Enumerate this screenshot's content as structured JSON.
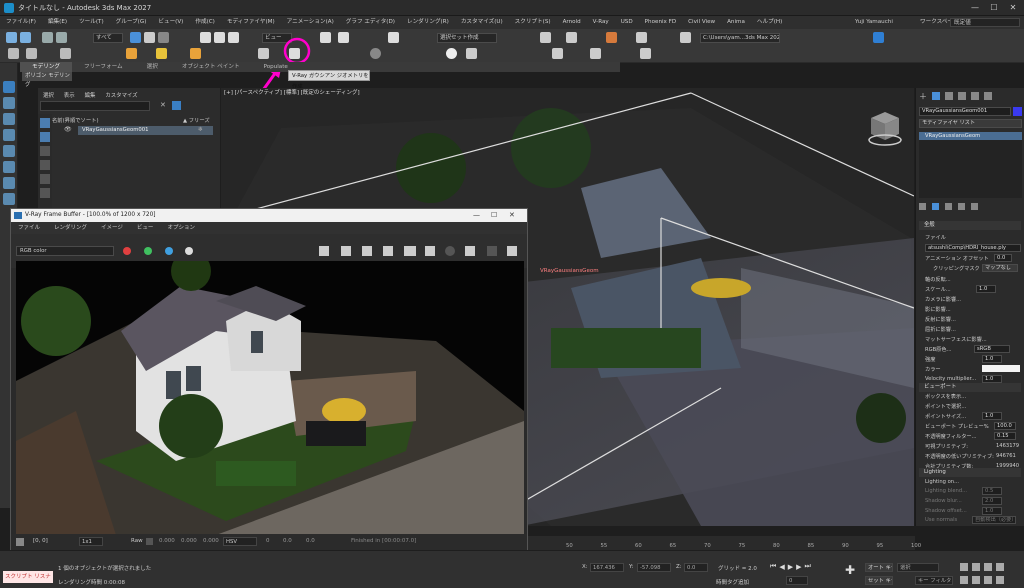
{
  "window": {
    "title": "タイトルなし - Autodesk 3ds Max 2027",
    "controls": [
      "—",
      "☐",
      "✕"
    ]
  },
  "menubar": {
    "items": [
      "ファイル(F)",
      "編集(E)",
      "ツール(T)",
      "グループ(G)",
      "ビュー(V)",
      "作成(C)",
      "モディファイヤ(M)",
      "アニメーション(A)",
      "グラフ エディタ(D)",
      "レンダリング(R)",
      "カスタマイズ(U)",
      "スクリプト(S)",
      "Arnold",
      "V-Ray",
      "USD",
      "Phoenix FD",
      "Civil View",
      "Anima",
      "ヘルプ(H)"
    ],
    "user": "Yuji Yamauchi",
    "workspace_label": "ワークスペース:",
    "workspace_value": "既定値"
  },
  "toolbar1": {
    "filter_dropdown": "すべて",
    "view_dropdown": "ビュー",
    "selection_set": "選択セット作成",
    "path_field": "C:\\Users\\yam...3ds Max 2027"
  },
  "ribbon": {
    "tabs": [
      "モデリング",
      "フリーフォーム",
      "選択",
      "オブジェクト ペイント",
      "Populate"
    ],
    "sub_button": "ポリゴン モデリング"
  },
  "tooltip": "V-Ray ガウシアン ジオメトリを作成",
  "explorer": {
    "menu": [
      "選択",
      "表示",
      "編集",
      "カスタマイズ"
    ],
    "column_name": "名前(昇順でソート)",
    "column_freeze": "▲ フリーズ",
    "item": "VRayGaussiansGeom001"
  },
  "viewport": {
    "label": "[+] [パースペクティブ] [標準] [既定のシェーディング]",
    "object_label": "VRayGaussiansGeom"
  },
  "command_panel": {
    "object_name": "VRayGaussiansGeom001",
    "modifier_list": "モディファイヤ リスト",
    "stack_item": "VRayGaussiansGeom",
    "section_general": "全般",
    "file_label": "ファイル",
    "file_path": "atsushi\\Comp\\HDRI_house.ply",
    "anim_offset_label": "アニメーション オフセット",
    "anim_offset_value": "0.0",
    "clipping_mask": "クリッピングマスク",
    "mapping": "マップなし",
    "axis_label": "軸の反転...",
    "scale_label": "スケール...",
    "scale_value": "1.0",
    "camera_effect": "カメラに影響...",
    "shadow_effect": "影に影響...",
    "reflect_effect": "反射に影響...",
    "refract_effect": "屈折に影響...",
    "matte_effect": "マットサーフェスに影響...",
    "rgb_color_label": "RGB原色...",
    "rgb_color_value": "sRGB",
    "brightness_label": "強度",
    "brightness_value": "1.0",
    "color_label": "カラー",
    "velocity_label": "Velocity multiplier...",
    "velocity_value": "1.0",
    "section_viewport": "ビューポート",
    "show_box": "ボックスを表示...",
    "point_select": "ポイントで選択...",
    "point_size_label": "ポイントサイズ...",
    "point_size_value": "1.0",
    "viewport_preview_label": "ビューポート プレビュー%",
    "viewport_preview_value": "100.0",
    "opacity_filter_label": "不透明度フィルター...",
    "opacity_filter_value": "0.15",
    "visible_primitives_label": "可視プリミティブ:",
    "visible_primitives_value": "1463179",
    "low_opacity_label": "不透明度の低いプリミティブ:",
    "low_opacity_value": "946761",
    "total_primitives_label": "合計プリミティブ数:",
    "total_primitives_value": "1999940",
    "section_lighting": "Lighting",
    "lighting_on": "Lighting on...",
    "lighting_blend_label": "Lighting blend...",
    "lighting_blend_value": "0.5",
    "shadow_blur_label": "Shadow blur...",
    "shadow_blur_value": "2.0",
    "shadow_offset_label": "Shadow offset...",
    "shadow_offset_value": "1.0",
    "use_normals_label": "Use normals",
    "use_normals_value": "自動検出（必要）"
  },
  "vfb": {
    "title": "V-Ray Frame Buffer - [100.0% of 1200 x 720]",
    "menu": [
      "ファイル",
      "レンダリング",
      "イメージ",
      "ビュー",
      "オプション"
    ],
    "channel": "RGB color",
    "coords": "[0, 0]",
    "zoom": "1x1",
    "raw": "Raw",
    "values": [
      "0.000",
      "0.000",
      "0.000"
    ],
    "mode": "HSV",
    "hsv": [
      "0",
      "0.0",
      "0.0"
    ],
    "finished": "Finished in [00:00:07.0]"
  },
  "timeline": {
    "ticks": [
      "50",
      "55",
      "60",
      "65",
      "70",
      "75",
      "80",
      "85",
      "90",
      "95",
      "100"
    ]
  },
  "bottombar": {
    "maxscript": "スクリプト リスナ",
    "selection_msg": "1 個のオブジェクトが選択されました",
    "render_time": "レンダリング時間 0:00:08",
    "x_label": "X:",
    "x_value": "167.436",
    "y_label": "Y:",
    "y_value": "-57.098",
    "z_label": "Z:",
    "z_value": "0.0",
    "grid": "グリッド = 2.0",
    "addtime": "時間タグ追加",
    "autokey": "オート キー",
    "setkey": "セット キー",
    "selected_label": "選択",
    "key_filters": "キー フィルタ...",
    "frame": "0"
  },
  "colors": {
    "accent_blue": "#2f7fd4",
    "highlight_magenta": "#ff00cc",
    "selection_label_red": "#ff6b6b"
  }
}
